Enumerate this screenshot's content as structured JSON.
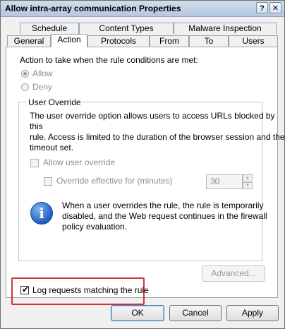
{
  "window": {
    "title": "Allow intra-array communication Properties",
    "help_glyph": "?",
    "close_glyph": "✕"
  },
  "tabs": {
    "row_back": [
      "Schedule",
      "Content Types",
      "Malware Inspection"
    ],
    "row_front": [
      "General",
      "Action",
      "Protocols",
      "From",
      "To",
      "Users"
    ],
    "active": "Action"
  },
  "action": {
    "prompt": "Action to take when the rule conditions are met:",
    "allow_label": "Allow",
    "deny_label": "Deny",
    "selected": "Allow"
  },
  "user_override": {
    "group_title": "User Override",
    "description_lines": [
      "The user override option allows users to access URLs blocked by this",
      "rule. Access is limited to the duration of the browser session and the",
      "timeout set."
    ],
    "allow_override_label": "Allow user override",
    "override_effective_label": "Override effective for (minutes)",
    "minutes_value": "30",
    "info_glyph": "i",
    "info_lines": [
      "When a user overrides the rule, the rule is temporarily",
      "disabled, and the Web request continues in the firewall",
      "policy evaluation."
    ],
    "advanced_label": "Advanced..."
  },
  "log": {
    "label": "Log requests matching the rule",
    "checked": true,
    "check_glyph": "✔"
  },
  "buttons": {
    "ok": "OK",
    "cancel": "Cancel",
    "apply": "Apply"
  },
  "colors": {
    "highlight_border": "#d0343a",
    "title_bar": "#b6c8df",
    "info_icon": "#1f5fbf"
  },
  "icons": {
    "info": "info-icon",
    "help": "help-icon",
    "close": "close-icon",
    "spin_up": "chevron-up-icon",
    "spin_down": "chevron-down-icon"
  }
}
